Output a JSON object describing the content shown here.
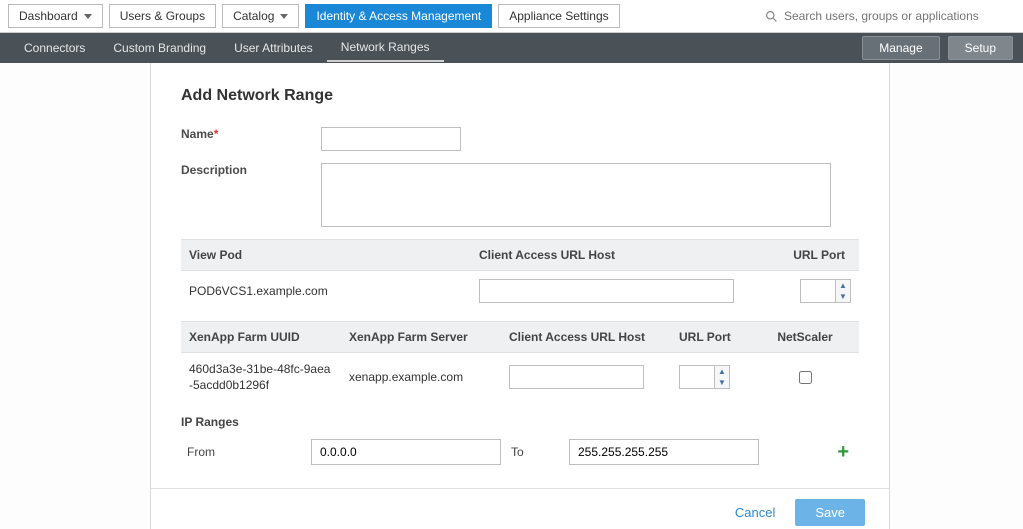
{
  "topnav": {
    "dashboard": "Dashboard",
    "users": "Users & Groups",
    "catalog": "Catalog",
    "iam": "Identity & Access Management",
    "appliance": "Appliance Settings",
    "search_placeholder": "Search users, groups or applications"
  },
  "subnav": {
    "connectors": "Connectors",
    "branding": "Custom Branding",
    "userattrs": "User Attributes",
    "netranges": "Network Ranges",
    "manage": "Manage",
    "setup": "Setup"
  },
  "dialog": {
    "title": "Add Network Range",
    "name_label": "Name",
    "desc_label": "Description",
    "name_value": "",
    "desc_value": ""
  },
  "viewpod": {
    "head_viewpod": "View Pod",
    "head_urlhost": "Client Access URL Host",
    "head_urlport": "URL Port",
    "row_pod": "POD6VCS1.example.com",
    "row_urlhost": "",
    "row_urlport": ""
  },
  "xenapp": {
    "head_uuid": "XenApp Farm UUID",
    "head_server": "XenApp Farm Server",
    "head_host": "Client Access URL Host",
    "head_port": "URL Port",
    "head_ns": "NetScaler",
    "row_uuid": "460d3a3e-31be-48fc-9aea-5acdd0b1296f",
    "row_server": "xenapp.example.com",
    "row_host": "",
    "row_port": "",
    "row_ns_checked": false
  },
  "ipr": {
    "section": "IP Ranges",
    "from_label": "From",
    "to_label": "To",
    "from_value": "0.0.0.0",
    "to_value": "255.255.255.255"
  },
  "footer": {
    "cancel": "Cancel",
    "save": "Save"
  }
}
